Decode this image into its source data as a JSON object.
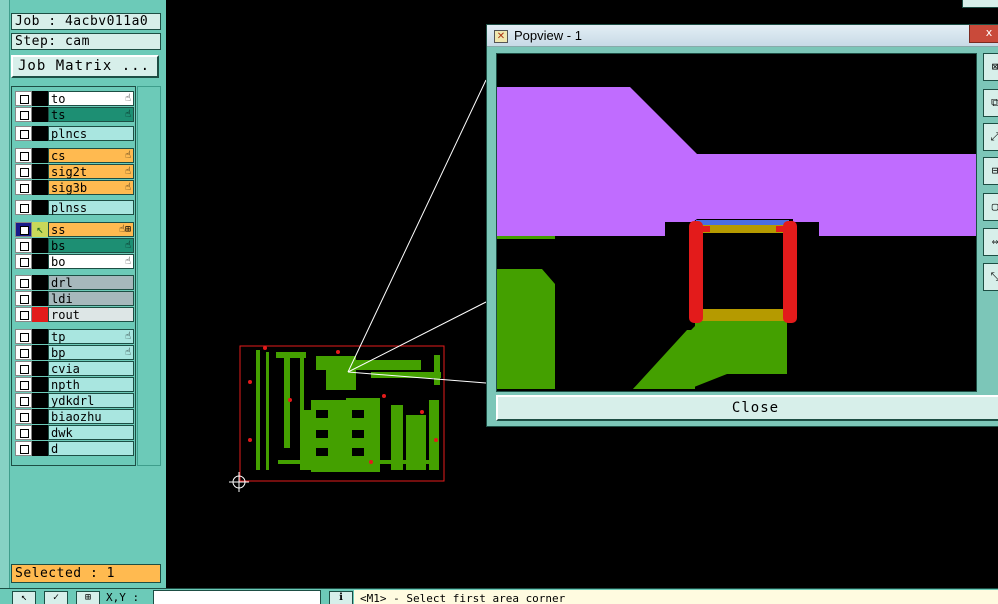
{
  "job": {
    "job_label": "Job : 4acbv011a0",
    "step_label": "Step: cam",
    "matrix_button": "Job Matrix ..."
  },
  "layers": [
    {
      "name": "to",
      "color": "white",
      "flag": "☝"
    },
    {
      "name": "ts",
      "color": "teal",
      "flag": "☝"
    },
    {
      "name": "plncs",
      "color": "cyan",
      "flag": ""
    },
    {
      "name": "cs",
      "color": "orange",
      "flag": "☝"
    },
    {
      "name": "sig2t",
      "color": "orange",
      "flag": "☝"
    },
    {
      "name": "sig3b",
      "color": "orange",
      "flag": "☝"
    },
    {
      "name": "plnss",
      "color": "cyan",
      "flag": ""
    },
    {
      "name": "ss",
      "color": "orange",
      "flag": "☝⊞"
    },
    {
      "name": "bs",
      "color": "teal",
      "flag": "☝"
    },
    {
      "name": "bo",
      "color": "white",
      "flag": "☝"
    },
    {
      "name": "drl",
      "color": "grey",
      "flag": ""
    },
    {
      "name": "ldi",
      "color": "grey",
      "flag": ""
    },
    {
      "name": "rout",
      "color": "light",
      "flag": ""
    },
    {
      "name": "tp",
      "color": "cyan",
      "flag": "☝"
    },
    {
      "name": "bp",
      "color": "cyan",
      "flag": "☝"
    },
    {
      "name": "cvia",
      "color": "cyan",
      "flag": ""
    },
    {
      "name": "npth",
      "color": "cyan",
      "flag": ""
    },
    {
      "name": "ydkdrl",
      "color": "cyan",
      "flag": ""
    },
    {
      "name": "biaozhu",
      "color": "cyan",
      "flag": ""
    },
    {
      "name": "dwk",
      "color": "cyan",
      "flag": ""
    },
    {
      "name": "d",
      "color": "cyan",
      "flag": ""
    }
  ],
  "selected_label": "Selected : 1",
  "popview": {
    "title": "Popview - 1",
    "close_button": "Close",
    "window_close_glyph": "x"
  },
  "toolbar": {
    "coord_label": "X,Y :",
    "status_text": "<M1> - Select first area corner"
  },
  "colors": {
    "panel": "#6ccab8",
    "layer_orange": "#ffba50",
    "layer_teal": "#1d8f73",
    "board_green": "#44a000",
    "violet": "#c06cff",
    "rout_red": "#e31b1b"
  }
}
